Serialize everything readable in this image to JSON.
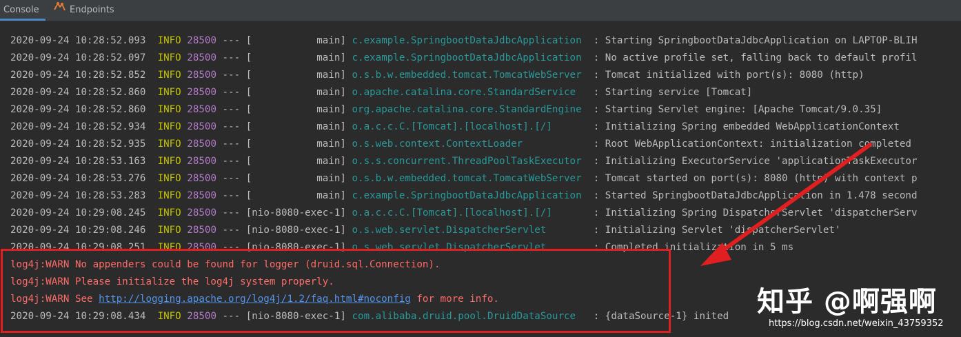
{
  "tabs": {
    "console_label": "Console",
    "endpoints_label": "Endpoints"
  },
  "log": {
    "lines": [
      {
        "ts": "2020-09-24 10:28:52.093",
        "level": "INFO",
        "pid": "28500",
        "sep": "---",
        "thread": "[           main]",
        "logger": "c.example.SpringbootDataJdbcApplication ",
        "msg": ": Starting SpringbootDataJdbcApplication on LAPTOP-BLIH"
      },
      {
        "ts": "2020-09-24 10:28:52.097",
        "level": "INFO",
        "pid": "28500",
        "sep": "---",
        "thread": "[           main]",
        "logger": "c.example.SpringbootDataJdbcApplication ",
        "msg": ": No active profile set, falling back to default profil"
      },
      {
        "ts": "2020-09-24 10:28:52.852",
        "level": "INFO",
        "pid": "28500",
        "sep": "---",
        "thread": "[           main]",
        "logger": "o.s.b.w.embedded.tomcat.TomcatWebServer ",
        "msg": ": Tomcat initialized with port(s): 8080 (http)"
      },
      {
        "ts": "2020-09-24 10:28:52.860",
        "level": "INFO",
        "pid": "28500",
        "sep": "---",
        "thread": "[           main]",
        "logger": "o.apache.catalina.core.StandardService  ",
        "msg": ": Starting service [Tomcat]"
      },
      {
        "ts": "2020-09-24 10:28:52.860",
        "level": "INFO",
        "pid": "28500",
        "sep": "---",
        "thread": "[           main]",
        "logger": "org.apache.catalina.core.StandardEngine ",
        "msg": ": Starting Servlet engine: [Apache Tomcat/9.0.35]"
      },
      {
        "ts": "2020-09-24 10:28:52.934",
        "level": "INFO",
        "pid": "28500",
        "sep": "---",
        "thread": "[           main]",
        "logger": "o.a.c.c.C.[Tomcat].[localhost].[/]      ",
        "msg": ": Initializing Spring embedded WebApplicationContext"
      },
      {
        "ts": "2020-09-24 10:28:52.935",
        "level": "INFO",
        "pid": "28500",
        "sep": "---",
        "thread": "[           main]",
        "logger": "o.s.web.context.ContextLoader           ",
        "msg": ": Root WebApplicationContext: initialization completed"
      },
      {
        "ts": "2020-09-24 10:28:53.163",
        "level": "INFO",
        "pid": "28500",
        "sep": "---",
        "thread": "[           main]",
        "logger": "o.s.s.concurrent.ThreadPoolTaskExecutor ",
        "msg": ": Initializing ExecutorService 'applicationTaskExecutor"
      },
      {
        "ts": "2020-09-24 10:28:53.276",
        "level": "INFO",
        "pid": "28500",
        "sep": "---",
        "thread": "[           main]",
        "logger": "o.s.b.w.embedded.tomcat.TomcatWebServer ",
        "msg": ": Tomcat started on port(s): 8080 (http) with context p"
      },
      {
        "ts": "2020-09-24 10:28:53.283",
        "level": "INFO",
        "pid": "28500",
        "sep": "---",
        "thread": "[           main]",
        "logger": "c.example.SpringbootDataJdbcApplication ",
        "msg": ": Started SpringbootDataJdbcApplication in 1.478 second"
      },
      {
        "ts": "2020-09-24 10:29:08.245",
        "level": "INFO",
        "pid": "28500",
        "sep": "---",
        "thread": "[nio-8080-exec-1]",
        "logger": "o.a.c.c.C.[Tomcat].[localhost].[/]      ",
        "msg": ": Initializing Spring DispatcherServlet 'dispatcherServ"
      },
      {
        "ts": "2020-09-24 10:29:08.246",
        "level": "INFO",
        "pid": "28500",
        "sep": "---",
        "thread": "[nio-8080-exec-1]",
        "logger": "o.s.web.servlet.DispatcherServlet       ",
        "msg": ": Initializing Servlet 'dispatcherServlet'"
      },
      {
        "ts": "2020-09-24 10:29:08.251",
        "level": "INFO",
        "pid": "28500",
        "sep": "---",
        "thread": "[nio-8080-exec-1]",
        "logger": "o.s.web.servlet.DispatcherServlet       ",
        "msg": ": Completed initialization in 5 ms"
      }
    ],
    "warn1": "log4j:WARN No appenders could be found for logger (druid.sql.Connection).",
    "warn2": "log4j:WARN Please initialize the log4j system properly.",
    "warn3_prefix": "log4j:WARN See ",
    "warn3_link": "http://logging.apache.org/log4j/1.2/faq.html#noconfig",
    "warn3_suffix": " for more info.",
    "last": {
      "ts": "2020-09-24 10:29:08.434",
      "level": "INFO",
      "pid": "28500",
      "sep": "---",
      "thread": "[nio-8080-exec-1]",
      "logger": "com.alibaba.druid.pool.DruidDataSource  ",
      "msg": ": {dataSource-1} inited"
    }
  },
  "watermark": {
    "brand": "知乎 @啊强啊",
    "url": "https://blog.csdn.net/weixin_43759352"
  },
  "colors": {
    "background": "#2b2b2b",
    "info_level": "#c3c300",
    "pid": "#b27cc9",
    "logger": "#299999",
    "warn": "#ff6b68",
    "link": "#5394ec",
    "highlight": "#e02020"
  }
}
